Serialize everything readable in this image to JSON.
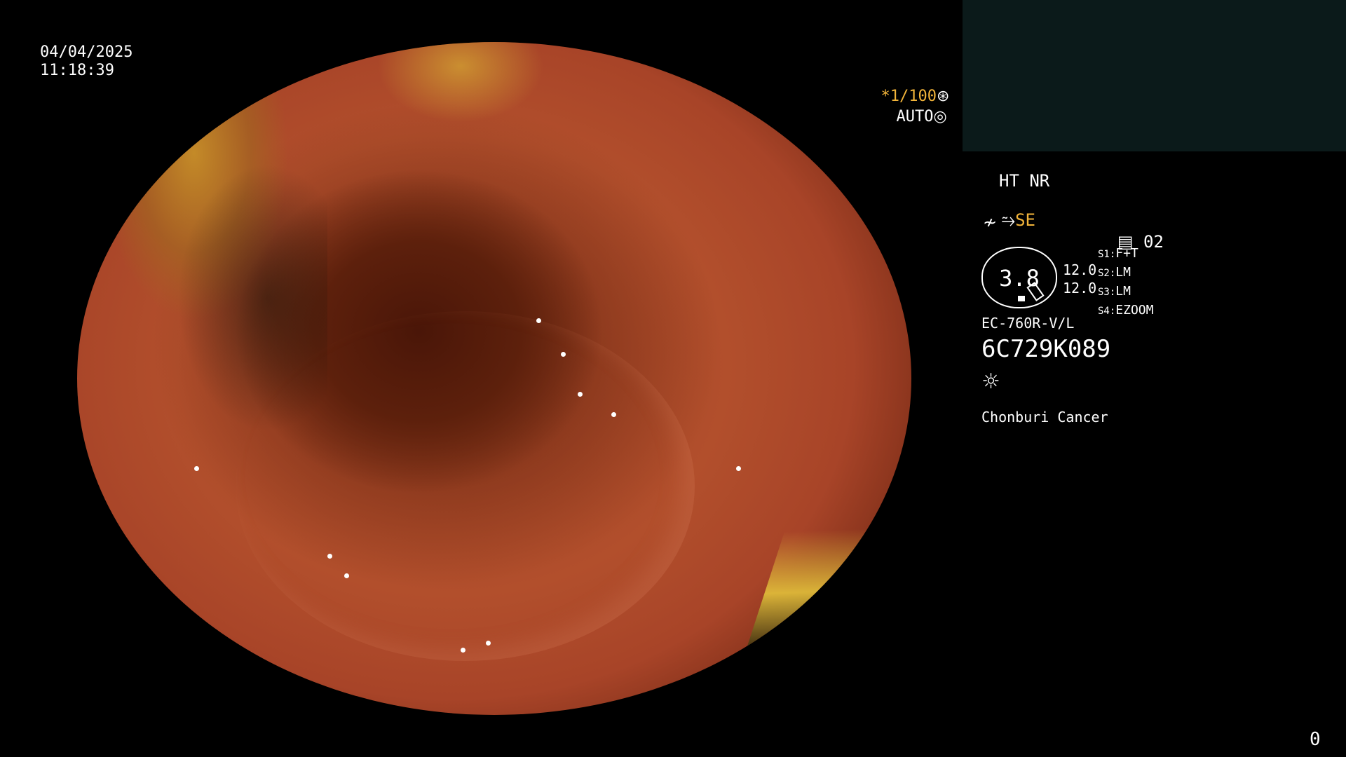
{
  "datetime": {
    "date": "04/04/2025",
    "time": "11:18:39"
  },
  "shutter": {
    "speed": "*1/100",
    "mode": "AUTO"
  },
  "processor": {
    "line1": "HT NR",
    "se_label": "SE",
    "preset_number": "02",
    "magnification": "3.8",
    "values": [
      "12.0",
      "12.0"
    ],
    "switches": [
      {
        "key": "S1:",
        "value": "F+T"
      },
      {
        "key": "S2:",
        "value": "LM"
      },
      {
        "key": "S3:",
        "value": "LM"
      },
      {
        "key": "S4:",
        "value": "EZOOM"
      }
    ],
    "scope_model": "EC-760R-V/L",
    "serial": "6C729K089",
    "institution": "Chonburi Cancer"
  },
  "counter": "0",
  "colors": {
    "accent": "#f2b43a",
    "text": "#ffffff",
    "background": "#000000"
  },
  "icons": [
    "shutter-icon",
    "iris-icon",
    "scope-icon",
    "structure-icon",
    "preset-icon",
    "light-icon"
  ]
}
